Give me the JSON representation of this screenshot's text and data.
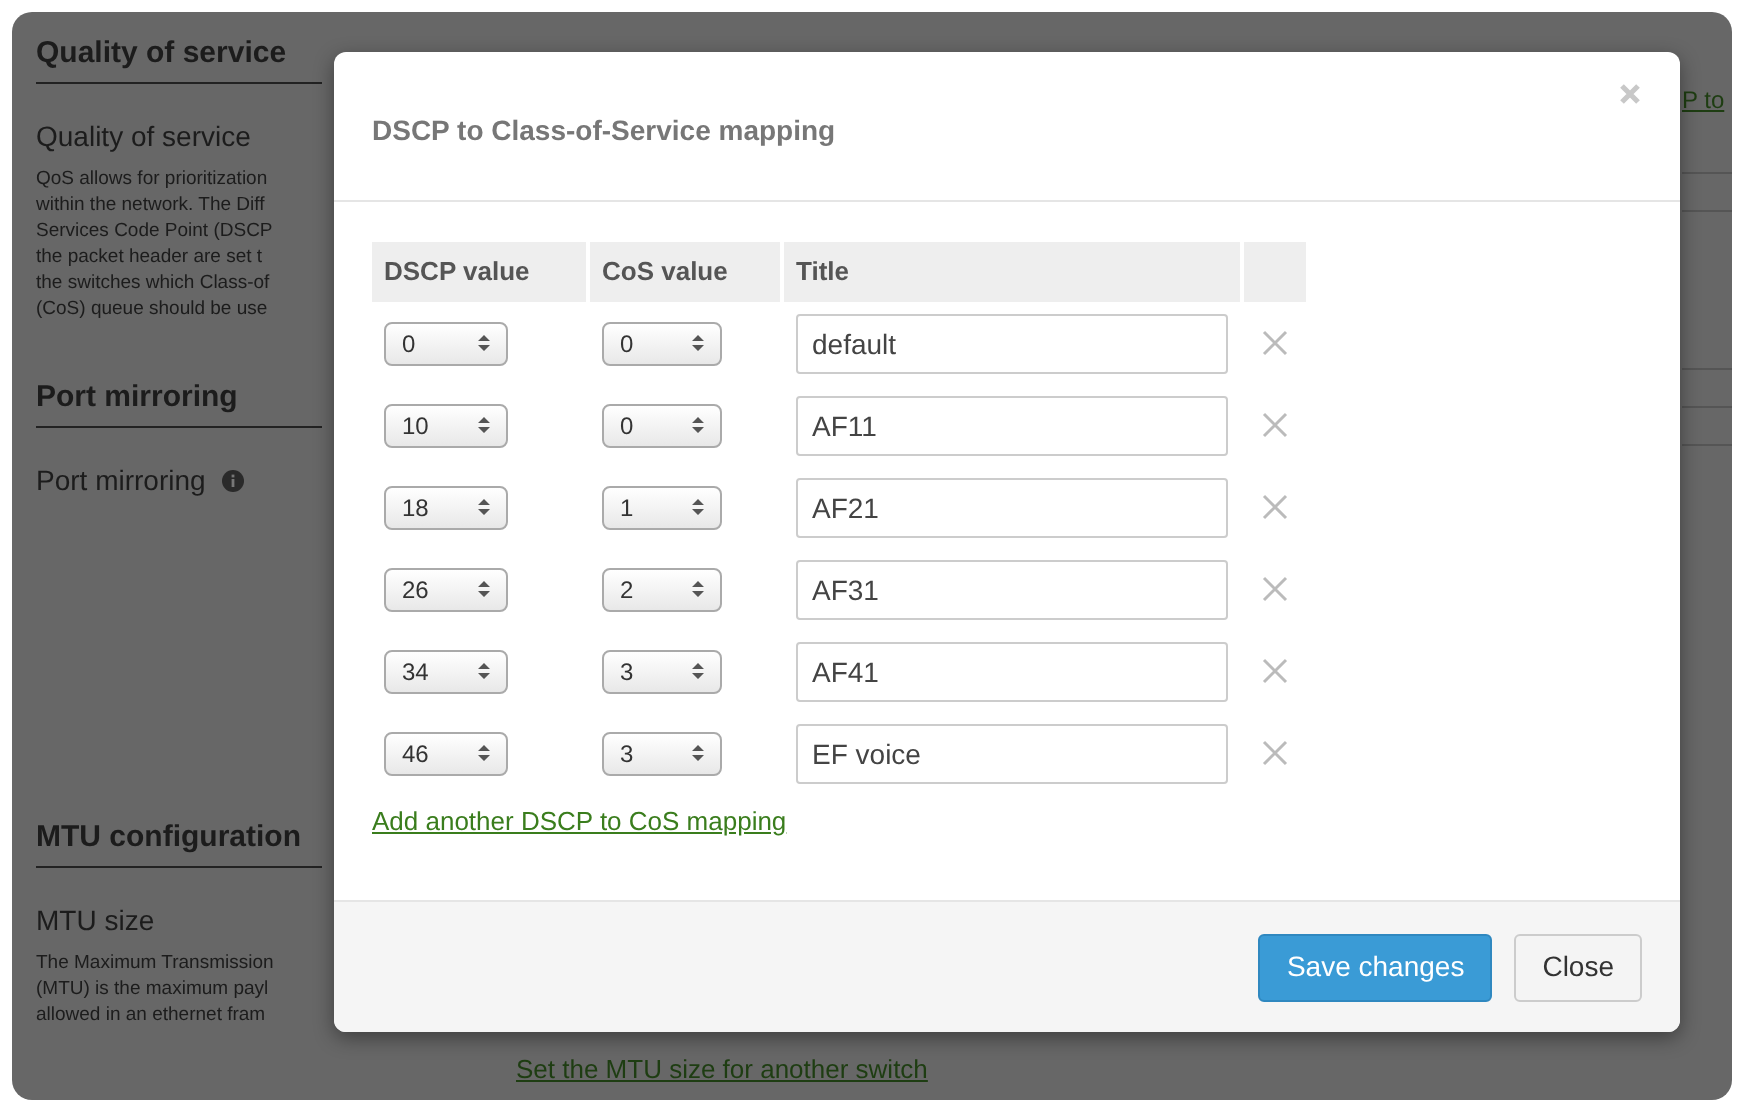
{
  "background": {
    "sections": [
      {
        "heading": "Quality of service",
        "label": "Quality of service",
        "info": false,
        "description": [
          "QoS allows for prioritization",
          "within the network. The Diff",
          "Services Code Point (DSCP",
          "the packet header are set t",
          "the switches which Class-of",
          "(CoS) queue should be use"
        ]
      },
      {
        "heading": "Port mirroring",
        "label": "Port mirroring",
        "info": true
      },
      {
        "heading": "MTU configuration",
        "label": "MTU size",
        "info": false,
        "description": [
          "The Maximum Transmission",
          "(MTU) is the maximum payl",
          "allowed in an ethernet fram"
        ]
      }
    ],
    "side_link": "P to",
    "bottom_link": "Set the MTU size for another switch"
  },
  "dialog": {
    "title": "DSCP to Class-of-Service mapping",
    "columns": [
      "DSCP value",
      "CoS value",
      "Title"
    ],
    "rows": [
      {
        "dscp": "0",
        "cos": "0",
        "title": "default"
      },
      {
        "dscp": "10",
        "cos": "0",
        "title": "AF11"
      },
      {
        "dscp": "18",
        "cos": "1",
        "title": "AF21"
      },
      {
        "dscp": "26",
        "cos": "2",
        "title": "AF31"
      },
      {
        "dscp": "34",
        "cos": "3",
        "title": "AF41"
      },
      {
        "dscp": "46",
        "cos": "3",
        "title": "EF voice"
      }
    ],
    "add_link": "Add another DSCP to CoS mapping",
    "buttons": [
      {
        "label": "Save changes",
        "kind": "primary"
      },
      {
        "label": "Close",
        "kind": "default"
      }
    ]
  }
}
